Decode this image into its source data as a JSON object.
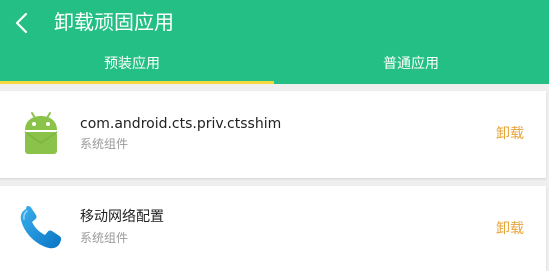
{
  "header": {
    "title": "卸载顽固应用",
    "back_icon": "chevron-left-icon",
    "background_color": "#24bf84"
  },
  "tabs": [
    {
      "label": "预装应用",
      "selected": true
    },
    {
      "label": "普通应用",
      "selected": false
    }
  ],
  "tab_indicator_color": "#f4d83e",
  "apps": [
    {
      "name": "com.android.cts.priv.ctsshim",
      "subtitle": "系统组件",
      "icon": "android-robot-icon",
      "action_label": "卸载"
    },
    {
      "name": "移动网络配置",
      "subtitle": "系统组件",
      "icon": "phone-handset-icon",
      "action_label": "卸载"
    }
  ],
  "action_color": "#e8a43a"
}
